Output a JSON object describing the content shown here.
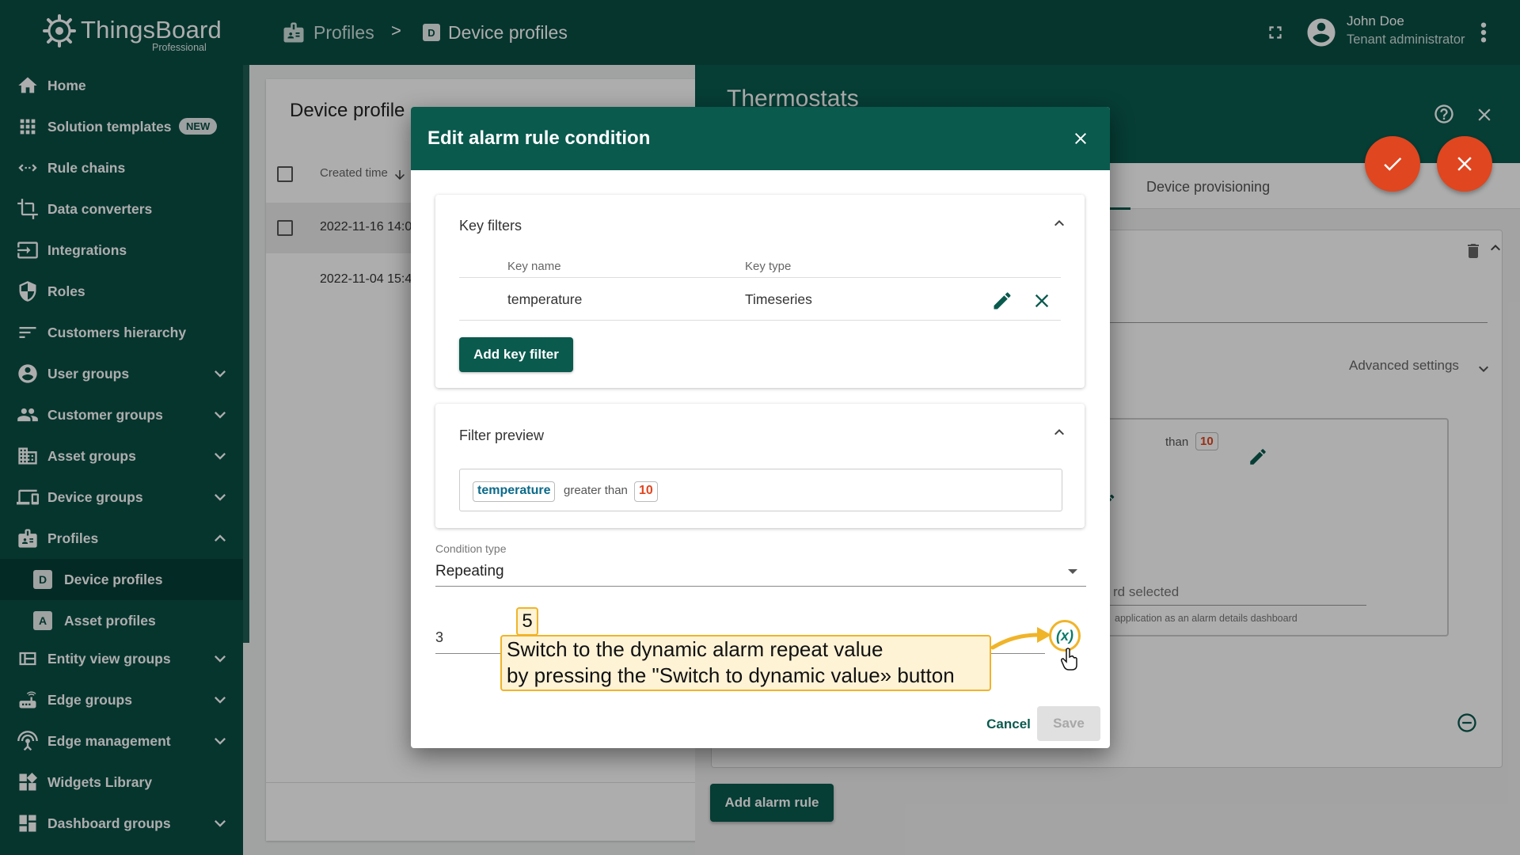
{
  "brand": {
    "name": "ThingsBoard",
    "edition": "Professional"
  },
  "breadcrumb": {
    "items": [
      "Profiles",
      "Device profiles"
    ],
    "separator": ">"
  },
  "user": {
    "name": "John Doe",
    "role": "Tenant administrator"
  },
  "sidebar": {
    "items": [
      {
        "label": "Home",
        "icon": "home-icon"
      },
      {
        "label": "Solution templates",
        "icon": "grid-icon",
        "badge": "NEW"
      },
      {
        "label": "Rule chains",
        "icon": "rule-chains-icon"
      },
      {
        "label": "Data converters",
        "icon": "crop-icon"
      },
      {
        "label": "Integrations",
        "icon": "input-icon"
      },
      {
        "label": "Roles",
        "icon": "shield-icon"
      },
      {
        "label": "Customers hierarchy",
        "icon": "sort-icon"
      },
      {
        "label": "User groups",
        "icon": "account-circle-icon",
        "expandable": true
      },
      {
        "label": "Customer groups",
        "icon": "people-icon",
        "expandable": true
      },
      {
        "label": "Asset groups",
        "icon": "domain-icon",
        "expandable": true
      },
      {
        "label": "Device groups",
        "icon": "devices-icon",
        "expandable": true
      },
      {
        "label": "Profiles",
        "icon": "badge-icon",
        "expandable": true,
        "expanded": true
      },
      {
        "label": "Device profiles",
        "icon": "device-profile-icon",
        "letter": "D",
        "sub": true,
        "active": true
      },
      {
        "label": "Asset profiles",
        "icon": "asset-profile-icon",
        "letter": "A",
        "sub": true
      },
      {
        "label": "Entity view groups",
        "icon": "view-quilt-icon",
        "expandable": true
      },
      {
        "label": "Edge groups",
        "icon": "router-icon",
        "expandable": true
      },
      {
        "label": "Edge management",
        "icon": "settings-input-antenna-icon",
        "expandable": true
      },
      {
        "label": "Widgets Library",
        "icon": "widgets-icon"
      },
      {
        "label": "Dashboard groups",
        "icon": "dashboard-icon",
        "expandable": true
      }
    ]
  },
  "list_panel": {
    "title": "Device profile",
    "column_created": "Created time",
    "rows": [
      {
        "created": "2022-11-16 14:0",
        "selected": true
      },
      {
        "created": "2022-11-04 15:4",
        "selected": false
      }
    ]
  },
  "detail": {
    "title": "Thermostats",
    "tab_visible": "Device provisioning",
    "advanced_settings": "Advanced settings",
    "inner_condition_fragment": {
      "op": "than",
      "value": "10"
    },
    "dashboard_field": "rd selected",
    "dashboard_hint": "application as an alarm details dashboard",
    "add_alarm_rule": "Add alarm rule"
  },
  "dialog": {
    "title": "Edit alarm rule condition",
    "key_filters": {
      "title": "Key filters",
      "columns": [
        "Key name",
        "Key type"
      ],
      "rows": [
        {
          "key_name": "temperature",
          "key_type": "Timeseries"
        }
      ],
      "add_button": "Add key filter"
    },
    "filter_preview": {
      "title": "Filter preview",
      "key": "temperature",
      "operation": "greater than",
      "value": "10"
    },
    "condition_type": {
      "label": "Condition type",
      "value": "Repeating"
    },
    "repeat_count": "3",
    "dynamic_button": "(x)",
    "cancel": "Cancel",
    "save": "Save"
  },
  "tutorial": {
    "step": "5",
    "text_line1": "Switch to the dynamic alarm repeat value",
    "text_line2": "by pressing the \"Switch to dynamic value» button"
  },
  "colors": {
    "primary": "#0a4e44",
    "header": "#0a5a4e",
    "accent": "#e0461f",
    "callout": "#fff3d6",
    "callout_border": "#f0b429",
    "preview_key": "#0b6a8a"
  }
}
